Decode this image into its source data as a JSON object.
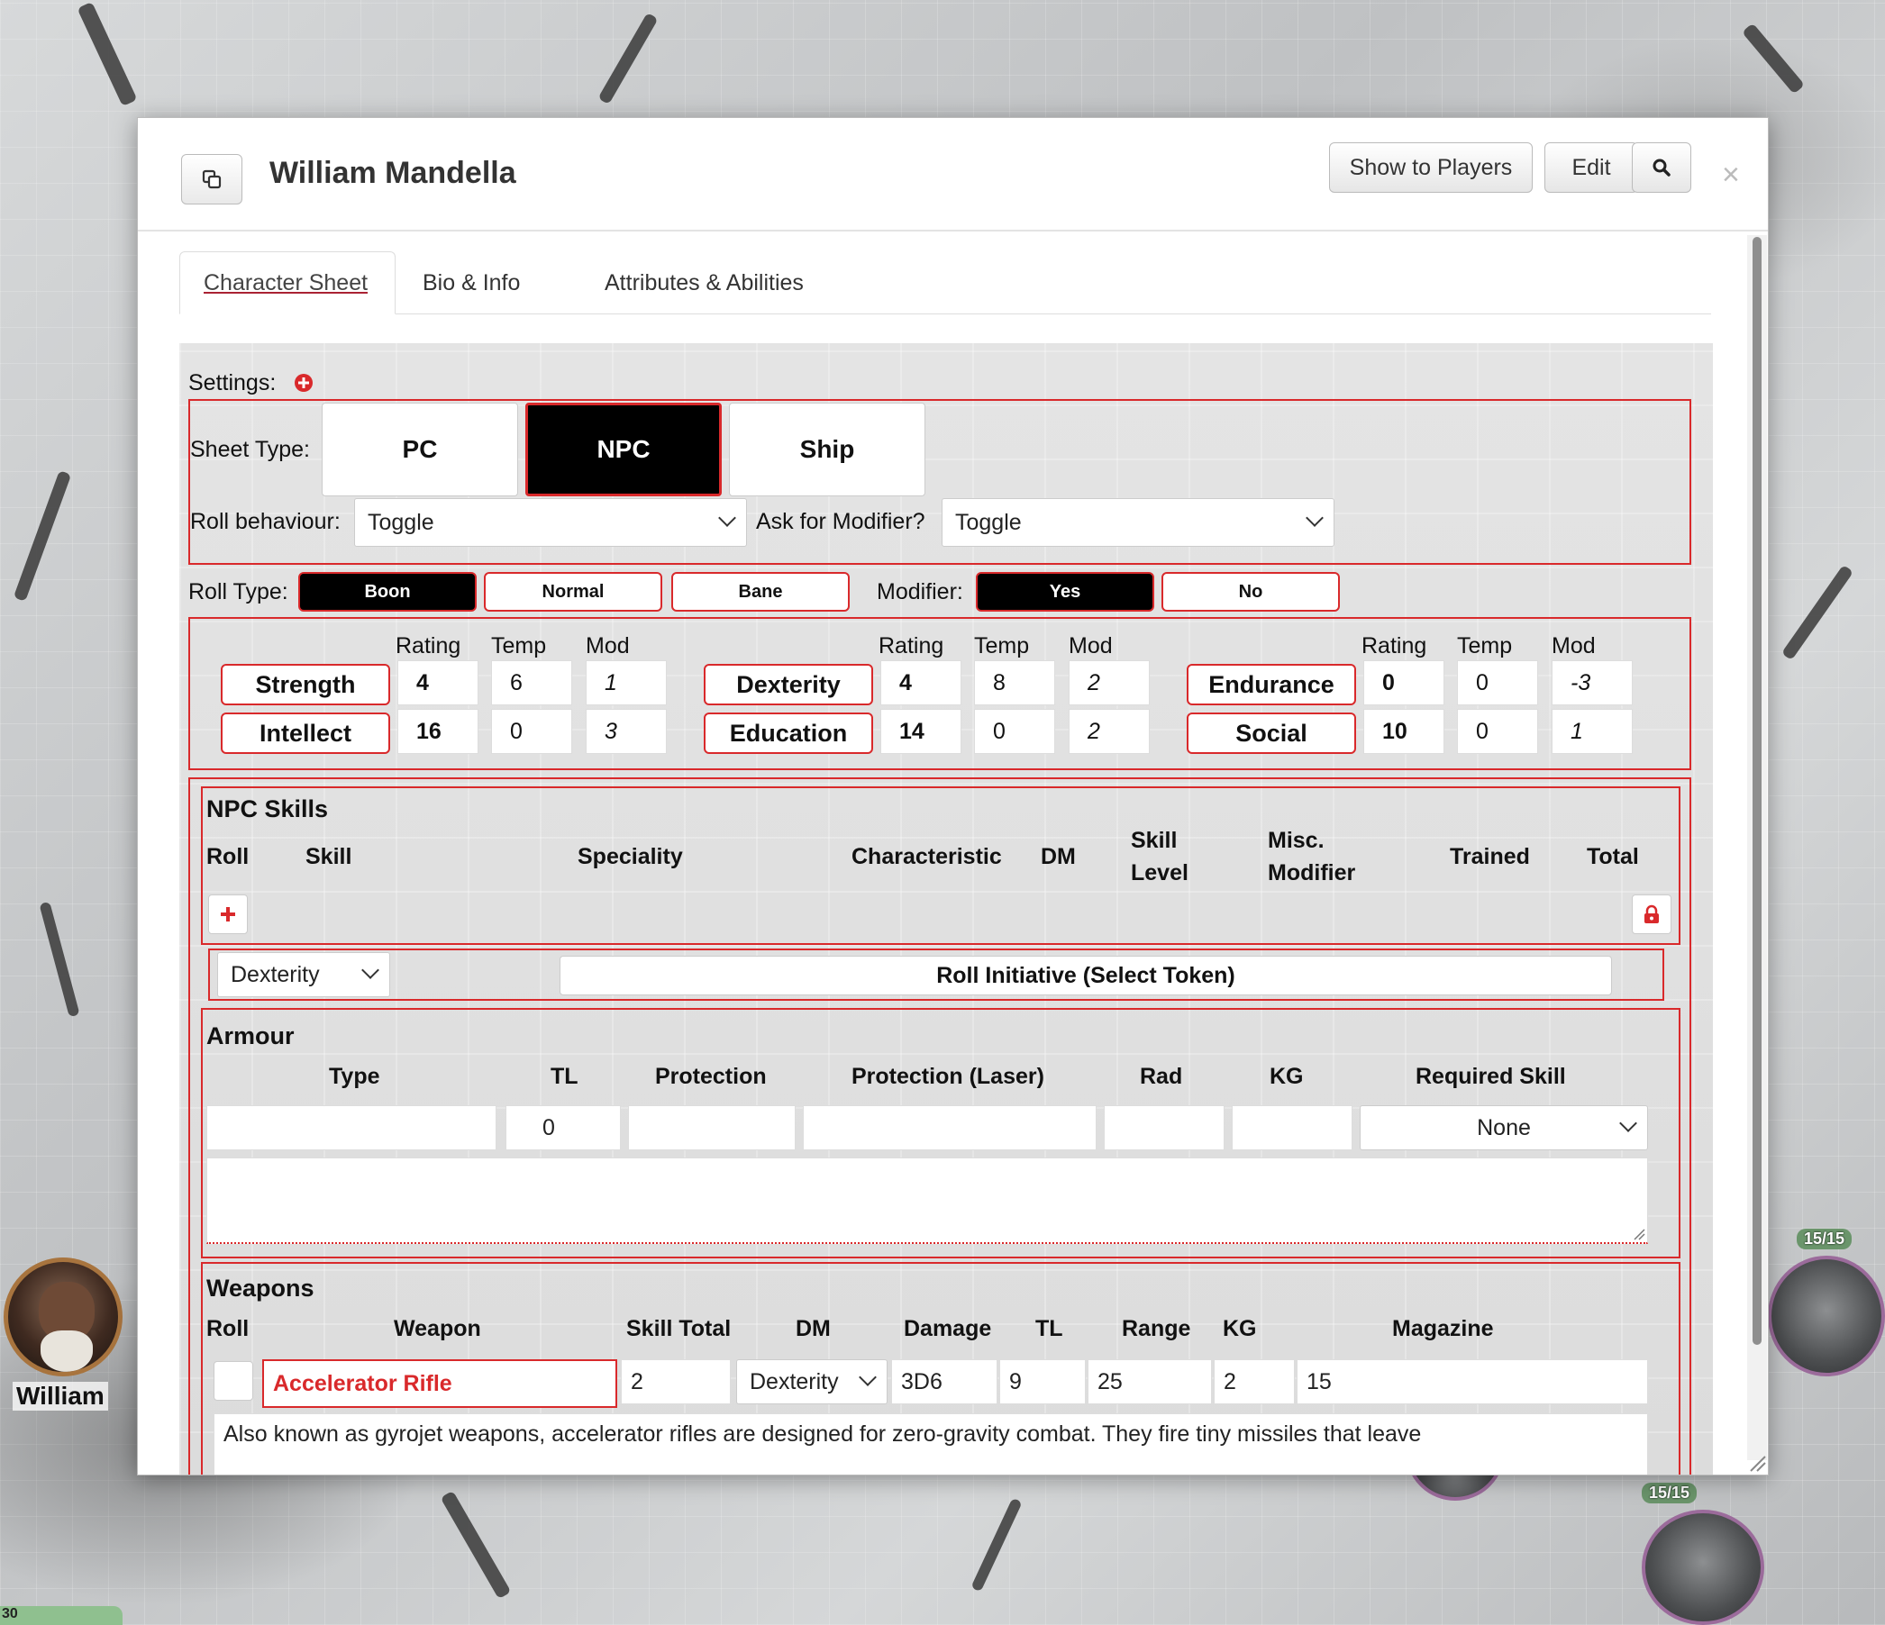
{
  "map": {
    "token_name": "William",
    "hp_badge_1": "15/15",
    "hp_badge_2": "15/15",
    "bottom_bar": "30"
  },
  "dialog": {
    "title": "William Mandella",
    "show_to_players": "Show to Players",
    "edit": "Edit",
    "close": "×"
  },
  "tabs": [
    {
      "label": "Character Sheet",
      "active": true
    },
    {
      "label": "Bio & Info"
    },
    {
      "label": "Attributes & Abilities"
    }
  ],
  "settings": {
    "label": "Settings:",
    "sheet_type_label": "Sheet Type:",
    "sheet_types": [
      "PC",
      "NPC",
      "Ship"
    ],
    "selected_sheet_type": "NPC",
    "roll_behaviour_label": "Roll behaviour:",
    "roll_behaviour_value": "Toggle",
    "ask_modifier_label": "Ask for Modifier?",
    "ask_modifier_value": "Toggle"
  },
  "roll_type": {
    "label": "Roll Type:",
    "options": [
      "Boon",
      "Normal",
      "Bane"
    ],
    "selected": "Boon",
    "modifier_label": "Modifier:",
    "modifier_options": [
      "Yes",
      "No"
    ],
    "modifier_selected": "Yes"
  },
  "characteristics": {
    "headers": {
      "rating": "Rating",
      "temp": "Temp",
      "mod": "Mod"
    },
    "items": [
      {
        "name": "Strength",
        "rating": "4",
        "temp": "6",
        "mod": "1"
      },
      {
        "name": "Dexterity",
        "rating": "4",
        "temp": "8",
        "mod": "2"
      },
      {
        "name": "Endurance",
        "rating": "0",
        "temp": "0",
        "mod": "-3"
      },
      {
        "name": "Intellect",
        "rating": "16",
        "temp": "0",
        "mod": "3"
      },
      {
        "name": "Education",
        "rating": "14",
        "temp": "0",
        "mod": "2"
      },
      {
        "name": "Social",
        "rating": "10",
        "temp": "0",
        "mod": "1"
      }
    ]
  },
  "npc_skills": {
    "title": "NPC Skills",
    "headers": {
      "roll": "Roll",
      "skill": "Skill",
      "speciality": "Speciality",
      "characteristic": "Characteristic",
      "dm": "DM",
      "skill_level_1": "Skill",
      "skill_level_2": "Level",
      "misc_1": "Misc.",
      "misc_2": "Modifier",
      "trained": "Trained",
      "total": "Total"
    },
    "initiative_select": "Dexterity",
    "initiative_button": "Roll Initiative (Select Token)"
  },
  "armour": {
    "title": "Armour",
    "headers": {
      "type": "Type",
      "tl": "TL",
      "protection": "Protection",
      "protection_laser": "Protection (Laser)",
      "rad": "Rad",
      "kg": "KG",
      "required_skill": "Required Skill"
    },
    "row": {
      "type": "",
      "tl": "0",
      "protection": "",
      "protection_laser": "",
      "rad": "",
      "kg": "",
      "required_skill": "None"
    }
  },
  "weapons": {
    "title": "Weapons",
    "headers": {
      "roll": "Roll",
      "weapon": "Weapon",
      "skill_total": "Skill Total",
      "dm": "DM",
      "damage": "Damage",
      "tl": "TL",
      "range": "Range",
      "kg": "KG",
      "magazine": "Magazine"
    },
    "rows": [
      {
        "weapon": "Accelerator Rifle",
        "skill_total": "2",
        "dm": "Dexterity",
        "damage": "3D6",
        "tl": "9",
        "range": "25",
        "kg": "2",
        "magazine": "15",
        "description": "Also known as gyrojet weapons, accelerator rifles are designed for zero-gravity combat. They fire tiny missiles that leave"
      }
    ]
  },
  "colors": {
    "accent_red": "#d9292b",
    "active_black": "#000000"
  }
}
